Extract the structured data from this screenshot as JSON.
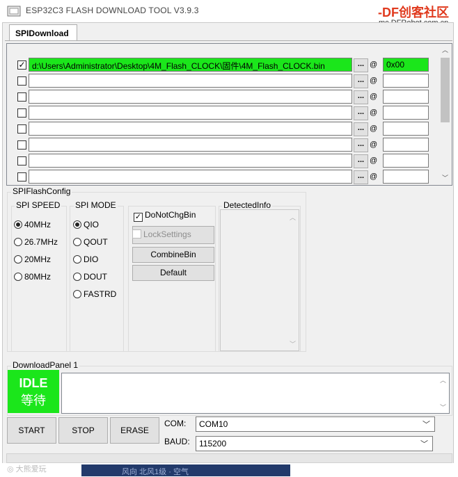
{
  "window": {
    "title": "ESP32C3 FLASH DOWNLOAD TOOL V3.9.3",
    "watermark_logo": "-DF创客社区",
    "watermark_url": "mc.DFRobot.com.cn"
  },
  "tabs": [
    {
      "label": "SPIDownload",
      "selected": true
    }
  ],
  "files": [
    {
      "checked": true,
      "path": "d:\\Users\\Administrator\\Desktop\\4M_Flash_CLOCK\\固件\\4M_Flash_CLOCK.bin",
      "browse": "...",
      "at": "@",
      "address": "0x00"
    },
    {
      "checked": false,
      "path": "",
      "browse": "...",
      "at": "@",
      "address": ""
    },
    {
      "checked": false,
      "path": "",
      "browse": "...",
      "at": "@",
      "address": ""
    },
    {
      "checked": false,
      "path": "",
      "browse": "...",
      "at": "@",
      "address": ""
    },
    {
      "checked": false,
      "path": "",
      "browse": "...",
      "at": "@",
      "address": ""
    },
    {
      "checked": false,
      "path": "",
      "browse": "...",
      "at": "@",
      "address": ""
    },
    {
      "checked": false,
      "path": "",
      "browse": "...",
      "at": "@",
      "address": ""
    },
    {
      "checked": false,
      "path": "",
      "browse": "...",
      "at": "@",
      "address": ""
    }
  ],
  "spi_flash_config": {
    "label": "SPIFlashConfig",
    "spi_speed": {
      "label": "SPI SPEED",
      "options": [
        "40MHz",
        "26.7MHz",
        "20MHz",
        "80MHz"
      ],
      "selected": "40MHz"
    },
    "spi_mode": {
      "label": "SPI MODE",
      "options": [
        "QIO",
        "QOUT",
        "DIO",
        "DOUT",
        "FASTRD"
      ],
      "selected": "QIO"
    },
    "do_not_chg_bin": {
      "label": "DoNotChgBin",
      "checked": true
    },
    "lock_settings": {
      "label": "LockSettings",
      "checked": false,
      "enabled": false
    },
    "combine_bin_label": "CombineBin",
    "default_label": "Default",
    "detected_info_label": "DetectedInfo"
  },
  "download_panel": {
    "label": "DownloadPanel 1",
    "status_en": "IDLE",
    "status_cn": "等待",
    "status_color": "#1be61b",
    "start_label": "START",
    "stop_label": "STOP",
    "erase_label": "ERASE",
    "com_label": "COM:",
    "com_value": "COM10",
    "baud_label": "BAUD:",
    "baud_value": "115200"
  },
  "footer": {
    "credit": "◎ 大熊爱玩",
    "strip_text": "风向 北风1级 · 空气"
  },
  "icons": {
    "check": "✓",
    "scroll_up": "︿",
    "scroll_down": "﹀",
    "chevron_down": "﹀"
  }
}
